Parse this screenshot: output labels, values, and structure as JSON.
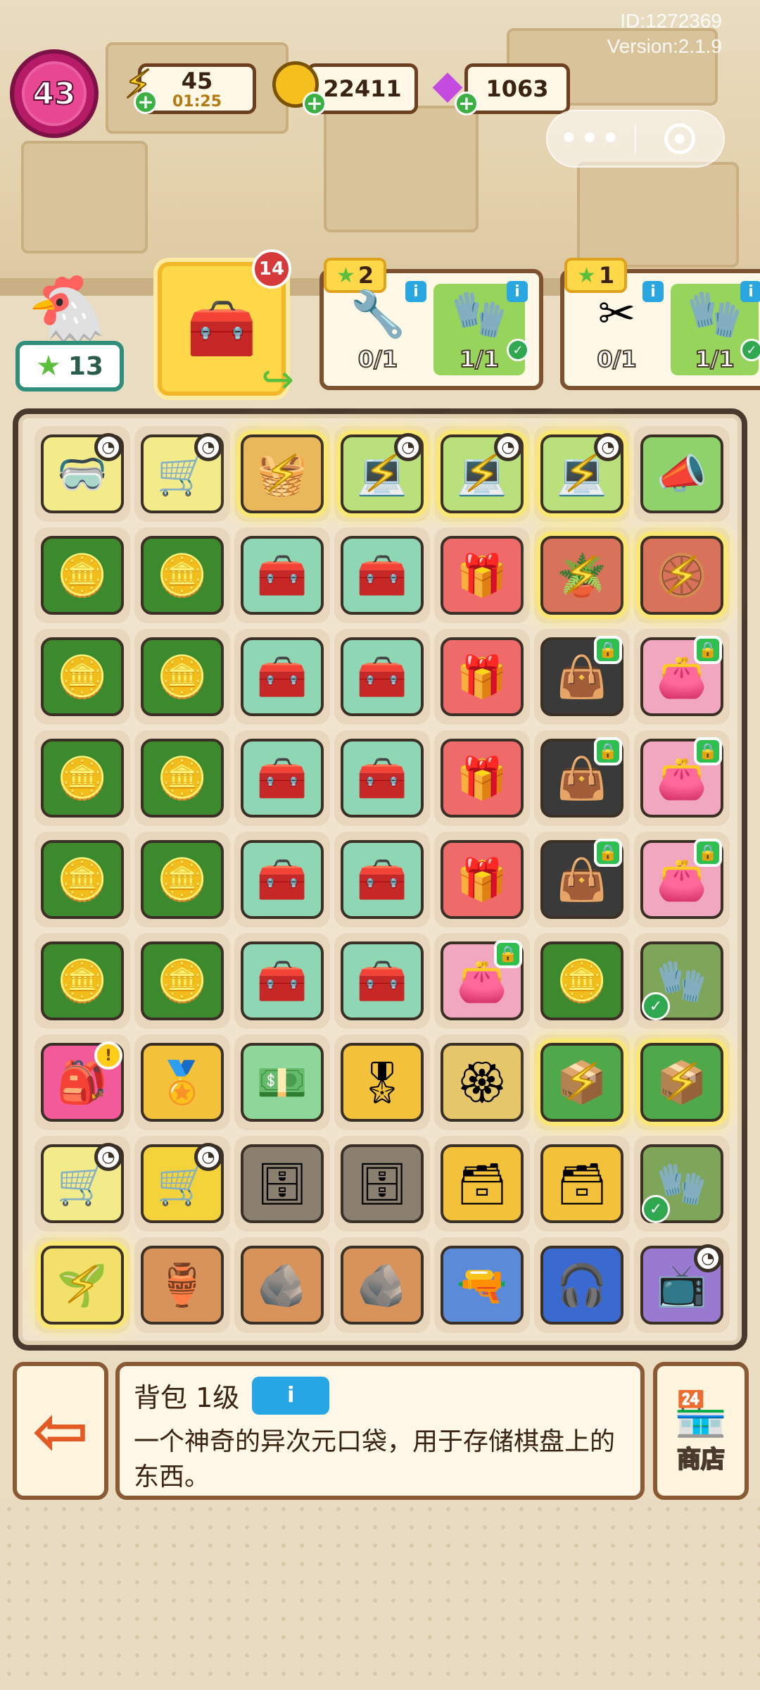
{
  "header": {
    "id_text": "ID:1272369",
    "version_text": "Version:2.1.9"
  },
  "hud": {
    "level": "43",
    "energy": {
      "icon": "lightning-bolt-icon",
      "value": "45",
      "timer": "01:25"
    },
    "coins": {
      "icon": "coin-icon",
      "value": "22411"
    },
    "gems": {
      "icon": "gem-icon",
      "value": "1063"
    },
    "plus_symbol": "+"
  },
  "miniprogram": {
    "more_icon": "•••",
    "close_icon": "target-close-icon"
  },
  "quest": {
    "helper_stars": "13",
    "main_item": {
      "icon": "toolbox-icon",
      "count": "14"
    },
    "tasks": [
      {
        "stars": "2",
        "items": [
          {
            "icon": "wrench-icon",
            "progress": "0/1",
            "done": false
          },
          {
            "icon": "glove-icon",
            "progress": "1/1",
            "done": true
          }
        ]
      },
      {
        "stars": "1",
        "items": [
          {
            "icon": "pliers-icon",
            "progress": "0/1",
            "done": false
          },
          {
            "icon": "glove-icon",
            "progress": "1/1",
            "done": true
          }
        ]
      }
    ]
  },
  "board": {
    "rows": [
      [
        "cart-goggles",
        "cart-tools",
        "basket-gold",
        "laptop",
        "laptop",
        "laptop",
        "megaphone"
      ],
      [
        "coin-crate",
        "coin-crate",
        "toolbox",
        "toolbox",
        "gift-box",
        "flower-pot",
        "wheelbarrow"
      ],
      [
        "coin-crate",
        "coin-crate",
        "toolbox",
        "toolbox",
        "gift-box",
        "black-bag",
        "pink-bag"
      ],
      [
        "coin-crate",
        "coin-crate",
        "toolbox",
        "toolbox",
        "gift-box",
        "black-bag",
        "pink-bag"
      ],
      [
        "coin-crate",
        "coin-crate",
        "toolbox",
        "toolbox",
        "gift-box",
        "black-bag",
        "pink-bag"
      ],
      [
        "coin-crate",
        "coin-crate",
        "toolbox",
        "toolbox",
        "pink-bag",
        "coin-crate",
        "glove"
      ],
      [
        "backpack",
        "gold-medal",
        "cash-stack",
        "ribbon-award",
        "gold-badge",
        "green-crate",
        "green-crate"
      ],
      [
        "shopping-cart",
        "yellow-cart",
        "locker",
        "locker",
        "gold-cabinet",
        "gold-cabinet",
        "glove"
      ],
      [
        "potted-plant",
        "clay-pot",
        "clay-shard",
        "clay-shard",
        "hair-dryer",
        "headphones",
        "junk-pile"
      ]
    ]
  },
  "info": {
    "title": "背包 1级",
    "info_button": "i",
    "description": "一个神奇的异次元口袋，用于存储棋盘上的东西。"
  },
  "buttons": {
    "exit_icon": "exit-door-icon",
    "shop_icon": "shop-awning-icon",
    "shop_label": "商店"
  }
}
